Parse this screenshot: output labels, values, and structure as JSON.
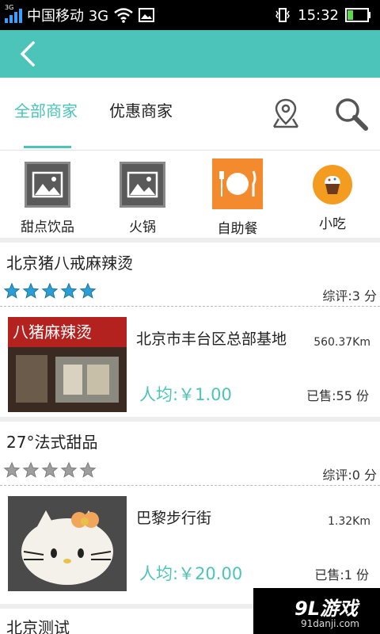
{
  "status": {
    "carrier": "中国移动 3G",
    "time": "15:32",
    "net_tag": "3G"
  },
  "tabs": {
    "all": "全部商家",
    "deals": "优惠商家"
  },
  "categories": [
    {
      "label": "甜点饮品",
      "icon": "image-placeholder-icon"
    },
    {
      "label": "火锅",
      "icon": "image-placeholder-icon"
    },
    {
      "label": "自助餐",
      "icon": "plate-fork-knife-icon"
    },
    {
      "label": "小吃",
      "icon": "cupcake-icon"
    }
  ],
  "shops": [
    {
      "name": "北京猪八戒麻辣烫",
      "rating": 5,
      "score": "综评:3 分",
      "address": "北京市丰台区总部基地",
      "distance": "560.37Km",
      "price": "人均:￥1.00",
      "sold": "已售:55 份",
      "sign_text": "八猪麻辣烫"
    },
    {
      "name": "27°法式甜品",
      "rating": 0,
      "score": "综评:0 分",
      "address": "巴黎步行街",
      "distance": "1.32Km",
      "price": "人均:￥20.00",
      "sold": "已售:1 份"
    },
    {
      "name": "北京测试"
    }
  ],
  "watermark": {
    "main": "9L游戏",
    "sub": "91danji.com"
  },
  "colors": {
    "accent": "#4cc4b9",
    "star_on": "#2a9fd6",
    "star_off": "#9e9e9e"
  }
}
